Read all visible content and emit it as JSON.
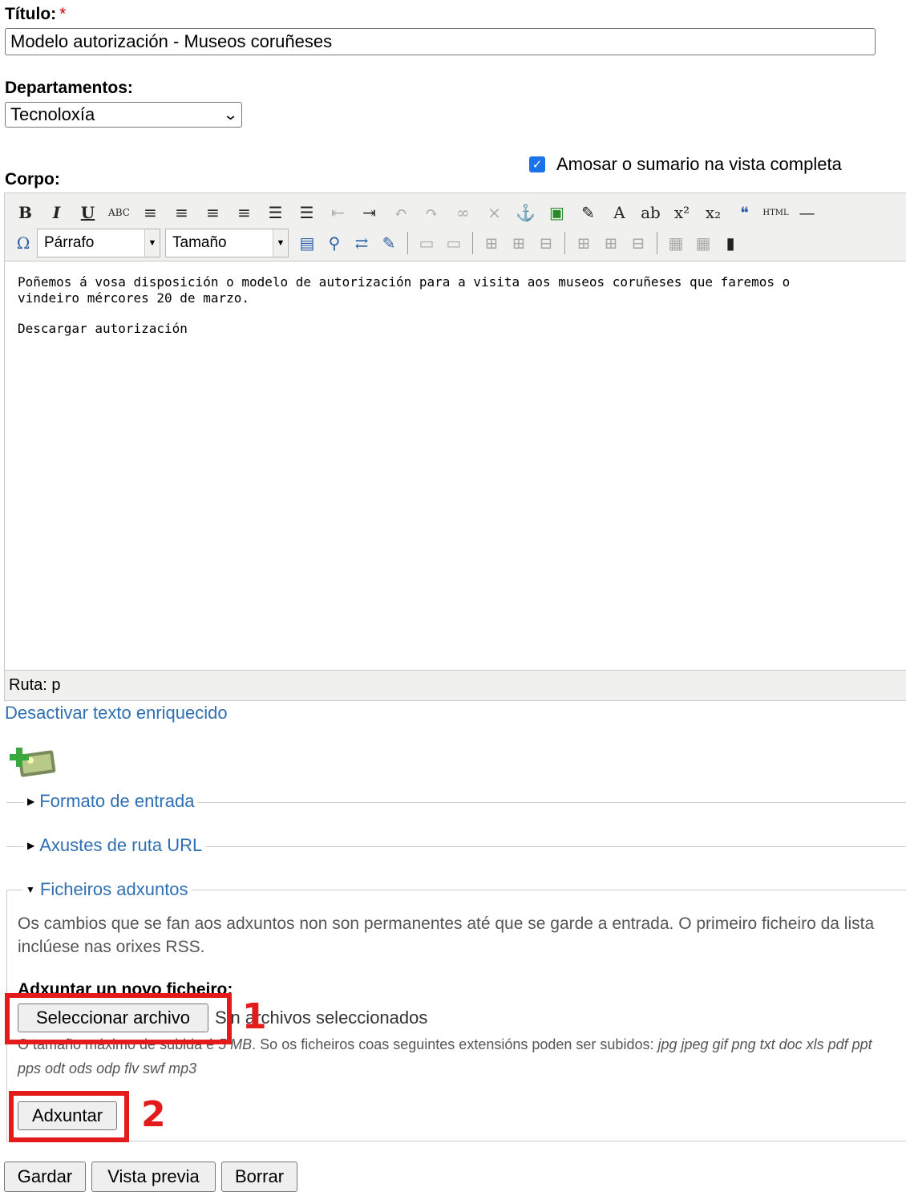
{
  "title_field": {
    "label": "Título:",
    "required_mark": "*",
    "value": "Modelo autorización - Museos coruñeses"
  },
  "departments": {
    "label": "Departamentos:",
    "selected": "Tecnoloxía"
  },
  "summary_option": {
    "label": "Amosar o sumario na vista completa",
    "checked": true
  },
  "body_field": {
    "label": "Corpo:",
    "toolbar": {
      "format_combo": "Párrafo",
      "size_combo": "Tamaño",
      "row1": [
        {
          "icon": "bold-icon",
          "glyph": "B"
        },
        {
          "icon": "italic-icon",
          "glyph": "I"
        },
        {
          "icon": "underline-icon",
          "glyph": "U"
        },
        {
          "icon": "strikethrough-icon",
          "glyph": "ABC"
        },
        {
          "icon": "align-left-icon",
          "glyph": "≡"
        },
        {
          "icon": "align-center-icon",
          "glyph": "≡"
        },
        {
          "icon": "align-right-icon",
          "glyph": "≡"
        },
        {
          "icon": "align-justify-icon",
          "glyph": "≡"
        },
        {
          "icon": "bullet-list-icon",
          "glyph": "☰"
        },
        {
          "icon": "numbered-list-icon",
          "glyph": "☰"
        },
        {
          "icon": "outdent-icon",
          "glyph": "⇤"
        },
        {
          "icon": "indent-icon",
          "glyph": "⇥"
        },
        {
          "icon": "undo-icon",
          "glyph": "↶"
        },
        {
          "icon": "redo-icon",
          "glyph": "↷"
        },
        {
          "icon": "link-icon",
          "glyph": "∞"
        },
        {
          "icon": "unlink-icon",
          "glyph": "⨯"
        },
        {
          "icon": "anchor-icon",
          "glyph": "⚓"
        },
        {
          "icon": "image-icon",
          "glyph": "▣"
        },
        {
          "icon": "cleanup-icon",
          "glyph": "✎"
        },
        {
          "icon": "text-color-icon",
          "glyph": "A"
        },
        {
          "icon": "highlight-color-icon",
          "glyph": "ab"
        },
        {
          "icon": "superscript-icon",
          "glyph": "x²"
        },
        {
          "icon": "subscript-icon",
          "glyph": "x₂"
        },
        {
          "icon": "blockquote-icon",
          "glyph": "❝"
        },
        {
          "icon": "html-icon",
          "glyph": "HTML"
        },
        {
          "icon": "horizontal-rule-icon",
          "glyph": "—"
        }
      ],
      "row2": [
        {
          "icon": "special-char-icon",
          "glyph": "Ω"
        },
        {
          "icon": "media-icon",
          "glyph": "▤"
        },
        {
          "icon": "find-icon",
          "glyph": "⚲"
        },
        {
          "icon": "replace-icon",
          "glyph": "⇄"
        },
        {
          "icon": "edit-icon",
          "glyph": "✎"
        },
        {
          "icon": "table-row-icon",
          "glyph": "▭"
        },
        {
          "icon": "table-cell-icon",
          "glyph": "▭"
        },
        {
          "icon": "insert-row-before-icon",
          "glyph": "⊞"
        },
        {
          "icon": "insert-row-after-icon",
          "glyph": "⊞"
        },
        {
          "icon": "delete-row-icon",
          "glyph": "⊟"
        },
        {
          "icon": "insert-col-before-icon",
          "glyph": "⊞"
        },
        {
          "icon": "insert-col-after-icon",
          "glyph": "⊞"
        },
        {
          "icon": "delete-col-icon",
          "glyph": "⊟"
        },
        {
          "icon": "table-icon",
          "glyph": "▦"
        },
        {
          "icon": "table-props-icon",
          "glyph": "▦"
        },
        {
          "icon": "film-icon",
          "glyph": "▮"
        }
      ]
    },
    "content": [
      "Poñemos á vosa disposición o modelo de autorización para a visita aos museos coruñeses que faremos o vindeiro mércores 20 de marzo.",
      "Descargar autorización"
    ],
    "path_label": "Ruta: p"
  },
  "disable_rich_text": "Desactivar texto enriquecido",
  "sections": {
    "input_format": "Formato de entrada",
    "url_settings": "Axustes de ruta URL",
    "attachments": "Ficheiros adxuntos"
  },
  "attachments": {
    "help": "Os cambios que se fan aos adxuntos non son permanentes até que se garde a entrada. O primeiro ficheiro da lista inclúese nas orixes RSS.",
    "new_file_label": "Adxuntar un novo ficheiro:",
    "choose_button": "Seleccionar archivo",
    "no_file_text": "Sin archivos seleccionados",
    "limits_prefix": "O tamaño máximo de subida é",
    "limits_size": "5 MB",
    "limits_middle": ". So os ficheiros coas seguintes extensións poden ser subidos:",
    "limits_ext": "jpg jpeg gif png txt doc xls pdf ppt pps odt ods odp flv swf mp3",
    "attach_button": "Adxuntar"
  },
  "annotations": {
    "marker_1": "1",
    "marker_2": "2",
    "color": "#e31b1b"
  },
  "actions": {
    "save": "Gardar",
    "preview": "Vista previa",
    "delete": "Borrar"
  }
}
